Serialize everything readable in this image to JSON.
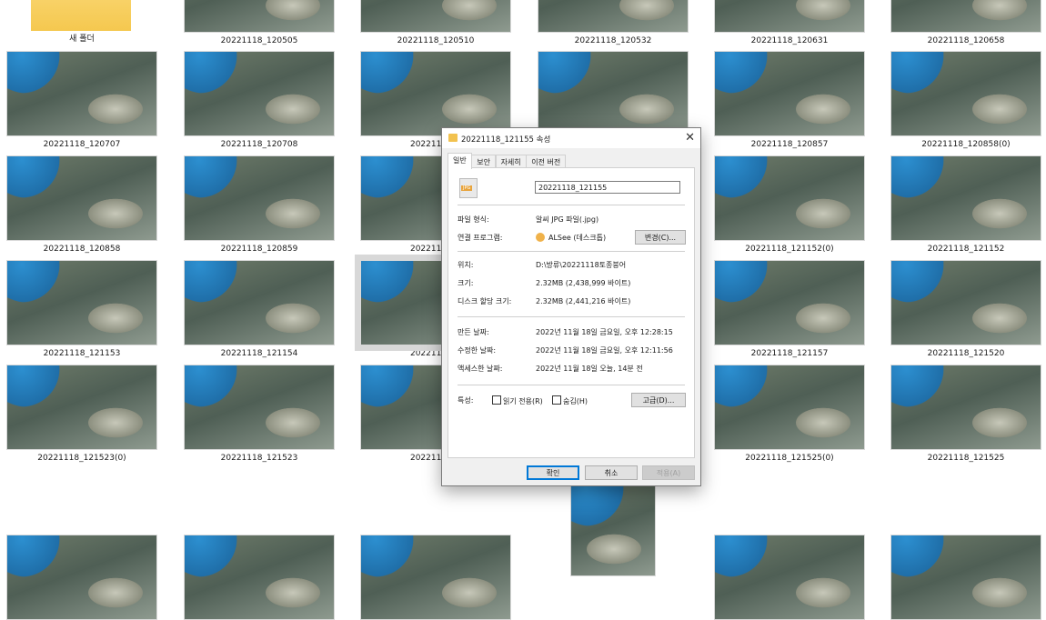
{
  "thumbs": {
    "r0": [
      "새 폴더",
      "20221118_120505",
      "20221118_120510",
      "20221118_120532",
      "20221118_120631",
      "20221118_120658"
    ],
    "r1": [
      "20221118_120707",
      "20221118_120708",
      "20221118_1",
      "20221118_120857",
      "20221118_120858(0)"
    ],
    "r2": [
      "20221118_120858",
      "20221118_120859",
      "20221118_1",
      "20221118_121152(0)",
      "20221118_121152"
    ],
    "r3": [
      "20221118_121153",
      "20221118_121154",
      "20221118_1",
      "20221118_121157",
      "20221118_121520"
    ],
    "r4": [
      "20221118_121523(0)",
      "20221118_121523",
      "20221118_1",
      "20221118_121525(0)",
      "20221118_121525"
    ]
  },
  "dialog": {
    "title": "20221118_121155 속성",
    "tabs": [
      "일반",
      "보안",
      "자세히",
      "이전 버전"
    ],
    "filename": "20221118_121155",
    "file_type_label": "파일 형식:",
    "file_type_value": "알씨 JPG 파일(.jpg)",
    "open_with_label": "연결 프로그램:",
    "open_with_value": "ALSee (데스크톱)",
    "change_button": "변경(C)...",
    "location_label": "위치:",
    "location_value": "D:\\방류\\20221118토종붕어",
    "size_label": "크기:",
    "size_value": "2.32MB (2,438,999 바이트)",
    "disk_size_label": "디스크 할당 크기:",
    "disk_size_value": "2.32MB (2,441,216 바이트)",
    "created_label": "만든 날짜:",
    "created_value": "2022년 11월 18일 금요일, 오후 12:28:15",
    "modified_label": "수정한 날짜:",
    "modified_value": "2022년 11월 18일 금요일, 오후 12:11:56",
    "accessed_label": "액세스한 날짜:",
    "accessed_value": "2022년 11월 18일 오늘, 14분 전",
    "attributes_label": "특성:",
    "readonly_label": "읽기 전용(R)",
    "hidden_label": "숨김(H)",
    "advanced_button": "고급(D)...",
    "ok_button": "확인",
    "cancel_button": "취소",
    "apply_button": "적용(A)"
  }
}
